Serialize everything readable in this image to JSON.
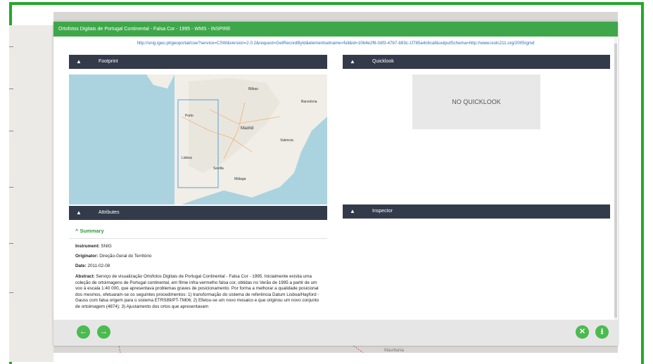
{
  "modal": {
    "title": "Ortofotos Digitais de Portugal Continental - Falsa Cor - 1995 - WMS - INSPIRE",
    "url": "http://snig.igeo.pt/geoportal/csw?service=CSW&version=2.0.2&request=GetRecordById&elementsetname=full&id=10b4e2f8-0df3-47b7-b93c-1f785a4c6caf&outputSchema=http://www.isotc211.org/2005/gmd"
  },
  "panels": {
    "footprint": "Footprint",
    "quicklook": "Quicklook",
    "attributes": "Attributes",
    "inspector": "Inspector",
    "no_quicklook": "NO QUICKLOOK"
  },
  "summary": {
    "title": "Summary",
    "instrument_label": "Instrument:",
    "instrument": "SNIG",
    "originator_label": "Originator:",
    "originator": "Direção-Geral do Território",
    "date_label": "Date:",
    "date": "2011-02-08",
    "abstract_label": "Abstract:",
    "abstract": "Serviço de visualização Ortofotos Digitais de Portugal Continental - Falsa Cor - 1995. Inicialmente existia uma coleção de ortoimagens de Portugal continental, em filme infra-vermelho falsa cor, obtidas no Verão de 1995 a partir de um voo à escala 1:40 000, que apresentava problemas graves de posicionamento. Por forma a melhorar a qualidade posicional dos mesmos, efetuaram-se os seguintes procedimentos: 1) transformação do sistema de referência Datum Lisboa/Hayford - Gauss com falsa origem para o sistema ETRS89/PT-TM06; 2) Efetou-se um novo mosaico e que originou um novo conjunto de ortoimagem (4874); 3) Ajustamento dos ortos que apresentavam"
  },
  "footer": {
    "back_icon": "←",
    "forward_icon": "→",
    "close_icon": "✕",
    "download_icon": "⭳"
  },
  "map_labels": [
    "Madrid",
    "Lisboa",
    "Porto",
    "Sevilla",
    "Málaga",
    "Valencia",
    "Barcelona",
    "Bilbao",
    "Mauritania"
  ]
}
